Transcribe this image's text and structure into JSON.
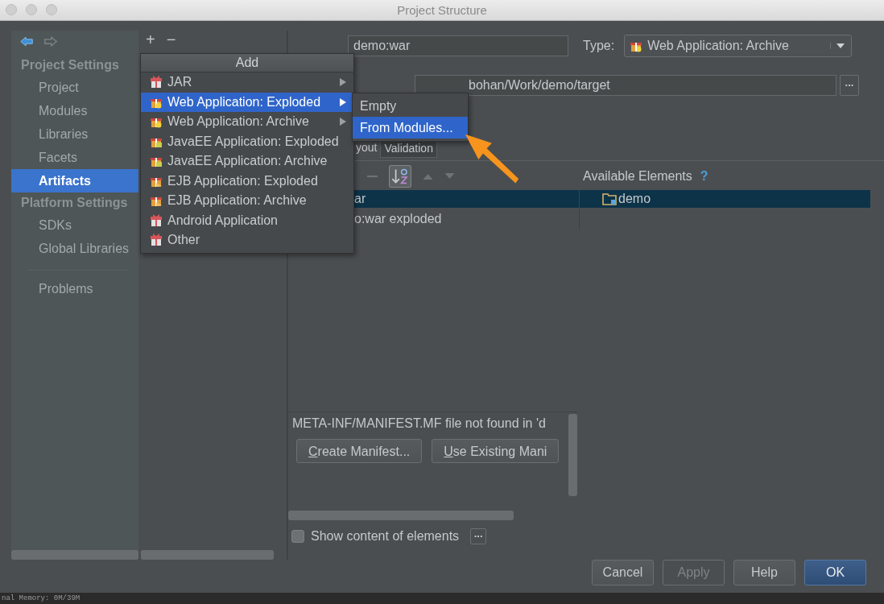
{
  "window": {
    "title": "Project Structure"
  },
  "sidebar": {
    "sections": [
      {
        "title": "Project Settings",
        "items": [
          {
            "label": "Project",
            "selected": false
          },
          {
            "label": "Modules",
            "selected": false
          },
          {
            "label": "Libraries",
            "selected": false
          },
          {
            "label": "Facets",
            "selected": false
          },
          {
            "label": "Artifacts",
            "selected": true
          }
        ]
      },
      {
        "title": "Platform Settings",
        "items": [
          {
            "label": "SDKs",
            "selected": false
          },
          {
            "label": "Global Libraries",
            "selected": false
          }
        ]
      }
    ],
    "extra_items": [
      {
        "label": "Problems",
        "selected": false
      }
    ]
  },
  "artifact_toolbar": {
    "add": "+",
    "remove": "−"
  },
  "add_menu": {
    "title": "Add",
    "items": [
      {
        "label": "JAR",
        "kind": "gift",
        "submenu": true,
        "selected": false
      },
      {
        "label": "Web Application: Exploded",
        "kind": "web",
        "submenu": true,
        "selected": true
      },
      {
        "label": "Web Application: Archive",
        "kind": "web",
        "submenu": true,
        "selected": false
      },
      {
        "label": "JavaEE Application: Exploded",
        "kind": "javaee",
        "submenu": false,
        "selected": false
      },
      {
        "label": "JavaEE Application: Archive",
        "kind": "javaee",
        "submenu": false,
        "selected": false
      },
      {
        "label": "EJB Application: Exploded",
        "kind": "ejb",
        "submenu": false,
        "selected": false
      },
      {
        "label": "EJB Application: Archive",
        "kind": "ejb",
        "submenu": false,
        "selected": false
      },
      {
        "label": "Android Application",
        "kind": "gift",
        "submenu": false,
        "selected": false
      },
      {
        "label": "Other",
        "kind": "gift",
        "submenu": false,
        "selected": false
      }
    ]
  },
  "submenu": {
    "items": [
      {
        "label": "Empty",
        "selected": false
      },
      {
        "label": "From Modules...",
        "selected": true
      }
    ]
  },
  "name_field": {
    "value": "demo:war"
  },
  "type_field": {
    "label": "Type:",
    "value": "Web Application: Archive"
  },
  "output_field": {
    "value": "bohan/Work/demo/target",
    "browse": "..."
  },
  "tabs": [
    {
      "label": "yout",
      "selected": true
    },
    {
      "label": "Validation",
      "selected": false
    }
  ],
  "layout_tree": {
    "rows": [
      {
        "label": "ar",
        "selected": true
      },
      {
        "label": "o:war exploded",
        "selected": false
      }
    ]
  },
  "available": {
    "title": "Available Elements",
    "help": "?",
    "rows": [
      {
        "label": "demo",
        "selected": true
      }
    ]
  },
  "manifest": {
    "message": "META-INF/MANIFEST.MF file not found in 'd",
    "buttons": [
      "Create Manifest...",
      "Use Existing Mani"
    ]
  },
  "show_content": {
    "label": "Show content of elements",
    "checked": false,
    "more": "..."
  },
  "buttons": [
    {
      "label": "Cancel",
      "kind": "normal"
    },
    {
      "label": "Apply",
      "kind": "disabled"
    },
    {
      "label": "Help",
      "kind": "normal"
    },
    {
      "label": "OK",
      "kind": "default"
    }
  ],
  "status_strip": {
    "text": "nal Memory: 0M/39M"
  }
}
